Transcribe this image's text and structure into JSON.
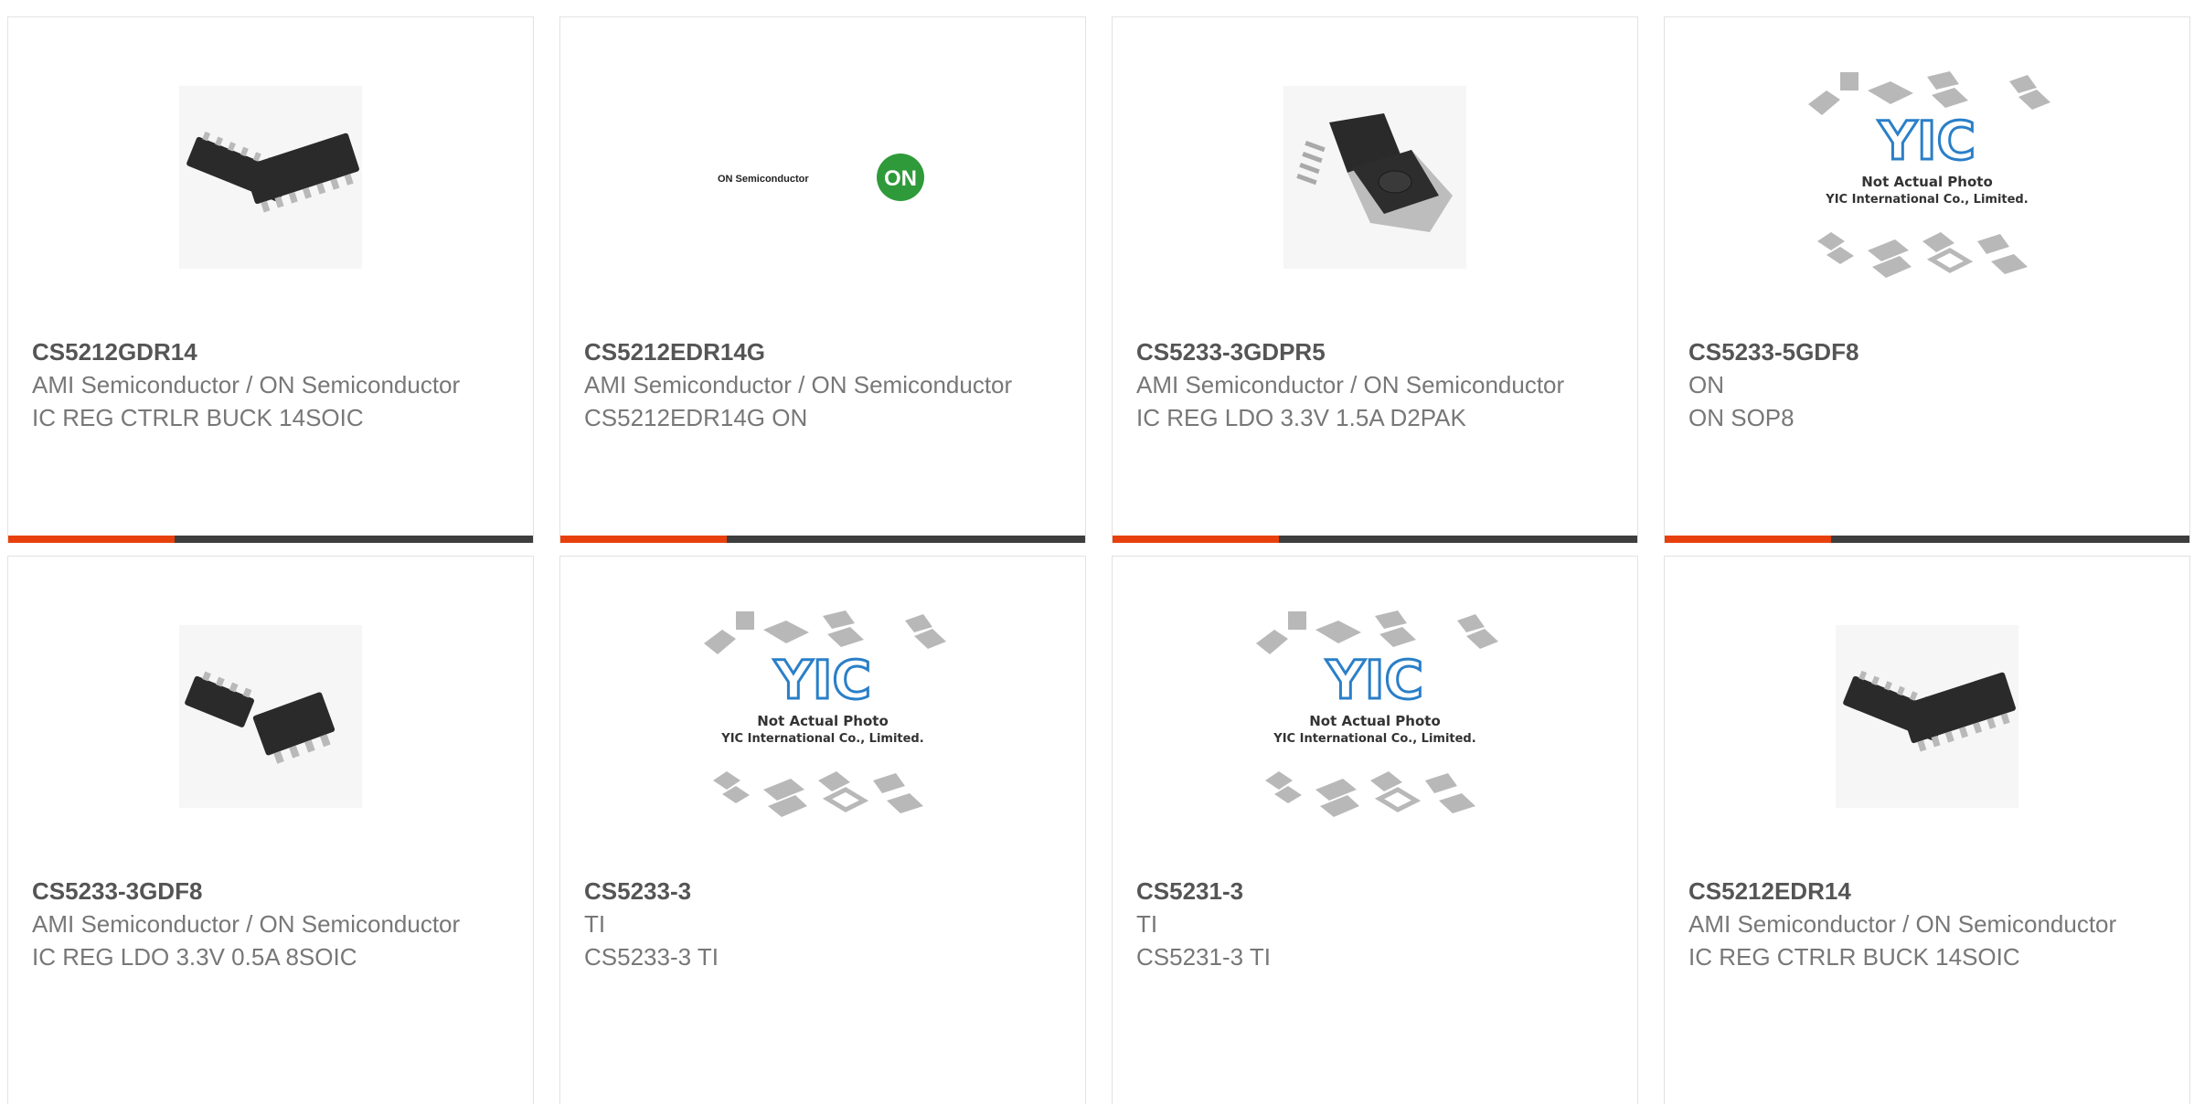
{
  "products": [
    {
      "part": "CS5212GDR14",
      "manufacturer": "AMI Semiconductor / ON Semiconductor",
      "description": "IC REG CTRLR BUCK 14SOIC",
      "image": "soic14-chip-photo"
    },
    {
      "part": "CS5212EDR14G",
      "manufacturer": "AMI Semiconductor / ON Semiconductor",
      "description": "CS5212EDR14G ON",
      "image": "on-semiconductor-logo",
      "logo_text": "ON Semiconductor",
      "logo_badge": "ON"
    },
    {
      "part": "CS5233-3GDPR5",
      "manufacturer": "AMI Semiconductor / ON Semiconductor",
      "description": "IC REG LDO 3.3V 1.5A D2PAK",
      "image": "d2pak-chip-photo"
    },
    {
      "part": "CS5233-5GDF8",
      "manufacturer": "ON",
      "description": "ON SOP8",
      "image": "yic-placeholder",
      "placeholder_logo": "YIC",
      "placeholder_line1": "Not Actual Photo",
      "placeholder_line2": "YIC International Co., Limited."
    },
    {
      "part": "CS5233-3GDF8",
      "manufacturer": "AMI Semiconductor / ON Semiconductor",
      "description": "IC REG LDO 3.3V 0.5A 8SOIC",
      "image": "soic8-chip-photo"
    },
    {
      "part": "CS5233-3",
      "manufacturer": "TI",
      "description": "CS5233-3 TI",
      "image": "yic-placeholder",
      "placeholder_logo": "YIC",
      "placeholder_line1": "Not Actual Photo",
      "placeholder_line2": "YIC International Co., Limited."
    },
    {
      "part": "CS5231-3",
      "manufacturer": "TI",
      "description": "CS5231-3 TI",
      "image": "yic-placeholder",
      "placeholder_logo": "YIC",
      "placeholder_line1": "Not Actual Photo",
      "placeholder_line2": "YIC International Co., Limited."
    },
    {
      "part": "CS5212EDR14",
      "manufacturer": "AMI Semiconductor / ON Semiconductor",
      "description": "IC REG CTRLR BUCK 14SOIC",
      "image": "soic14-chip-photo"
    }
  ],
  "colors": {
    "accent": "#e8400c",
    "bar": "#3e3e3e",
    "border": "#e2e2e2",
    "part_text": "#555555",
    "meta_text": "#777777"
  }
}
